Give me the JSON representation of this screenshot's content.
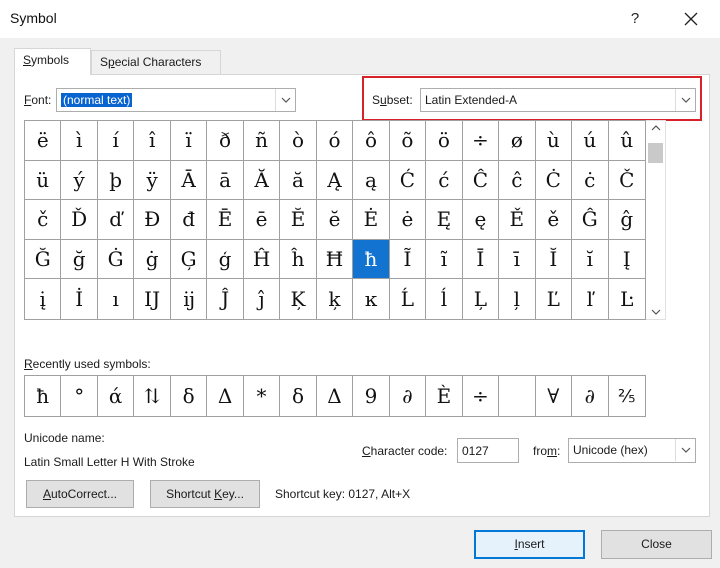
{
  "window": {
    "title": "Symbol",
    "help_label": "?"
  },
  "tabs": {
    "symbols": "Symbols",
    "symbols_key": "S",
    "special": "Special Characters",
    "special_key": "p"
  },
  "font": {
    "label_key": "F",
    "label_rest": "ont:",
    "value": "(normal text)"
  },
  "subset": {
    "label_pre": "S",
    "label_key": "u",
    "label_rest": "bset:",
    "value": "Latin Extended-A",
    "highlight_color": "#d8222a"
  },
  "symbol_rows": [
    [
      "ë",
      "ì",
      "í",
      "î",
      "ï",
      "ð",
      "ñ",
      "ò",
      "ó",
      "ô",
      "õ",
      "ö",
      "÷",
      "ø",
      "ù",
      "ú",
      "û"
    ],
    [
      "ü",
      "ý",
      "þ",
      "ÿ",
      "Ā",
      "ā",
      "Ă",
      "ă",
      "Ą",
      "ą",
      "Ć",
      "ć",
      "Ĉ",
      "ĉ",
      "Ċ",
      "ċ",
      "Č"
    ],
    [
      "č",
      "Ď",
      "ď",
      "Đ",
      "đ",
      "Ē",
      "ē",
      "Ĕ",
      "ĕ",
      "Ė",
      "ė",
      "Ę",
      "ę",
      "Ě",
      "ě",
      "Ĝ",
      "ĝ"
    ],
    [
      "Ğ",
      "ğ",
      "Ġ",
      "ġ",
      "Ģ",
      "ģ",
      "Ĥ",
      "ĥ",
      "Ħ",
      "ħ",
      "Ĩ",
      "ĩ",
      "Ī",
      "ī",
      "Ĭ",
      "ĭ",
      "Į"
    ],
    [
      "į",
      "İ",
      "ı",
      "Ĳ",
      "ĳ",
      "Ĵ",
      "ĵ",
      "Ķ",
      "ķ",
      "ĸ",
      "Ĺ",
      "ĺ",
      "Ļ",
      "ļ",
      "Ľ",
      "ľ",
      "Ŀ"
    ]
  ],
  "selected_symbol": "ħ",
  "recent": {
    "label_key": "R",
    "label_rest": "ecently used symbols:",
    "symbols": [
      "ħ",
      "°",
      "ά",
      "⇅",
      "δ",
      "Δ",
      "*",
      "δ",
      "Δ",
      "9",
      "∂",
      "È",
      "÷",
      "",
      "∀",
      "∂",
      "⅖"
    ]
  },
  "unicode_name": {
    "label": "Unicode name:",
    "value": "Latin Small Letter H With Stroke"
  },
  "character_code": {
    "label_key": "C",
    "label_rest": "haracter code:",
    "value": "0127"
  },
  "from": {
    "label_pre": "fro",
    "label_key": "m",
    "label_rest": ":",
    "value": "Unicode (hex)"
  },
  "buttons": {
    "autocorrect_key": "A",
    "autocorrect_rest": "utoCorrect...",
    "shortcut_pre": "Shortcut ",
    "shortcut_key": "K",
    "shortcut_rest": "ey...",
    "insert_key": "I",
    "insert_rest": "nsert",
    "close": "Close"
  },
  "shortcut_key_text": "Shortcut key: 0127, Alt+X",
  "colors": {
    "selection": "#1273d1",
    "dialog_bg": "#f0f0f0",
    "accent": "#0078d7"
  }
}
